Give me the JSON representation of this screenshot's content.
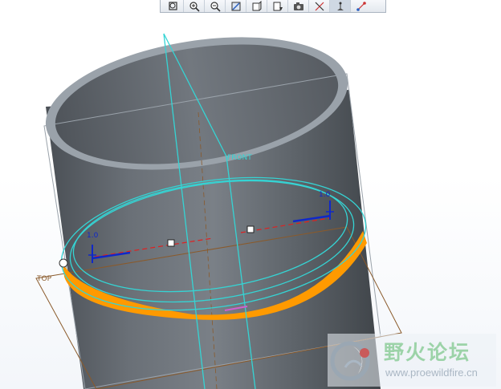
{
  "toolbar": {
    "buttons": [
      {
        "name": "refit-icon"
      },
      {
        "name": "zoom-in-icon"
      },
      {
        "name": "zoom-out-icon"
      },
      {
        "name": "repaint-icon"
      },
      {
        "name": "display-style-icon"
      },
      {
        "name": "saved-view-icon"
      },
      {
        "name": "camera-icon"
      },
      {
        "name": "datum-axis-icon"
      },
      {
        "name": "datum-point-icon"
      },
      {
        "name": "datum-csys-icon"
      }
    ]
  },
  "model": {
    "cylinder_color": "#5f656c",
    "rim_color": "#9aa2aa",
    "highlight_color": "#ff9a00",
    "sketch_color": "#35d4d4",
    "datum_plane_color": "#8a5a2b"
  },
  "labels": {
    "front_plane": "FRONT",
    "top_plane": "TOP",
    "dim_left": "1.0",
    "dim_right": "1.0"
  },
  "watermark": {
    "cn": "野火论坛",
    "url": "www.proewildfire.cn"
  }
}
